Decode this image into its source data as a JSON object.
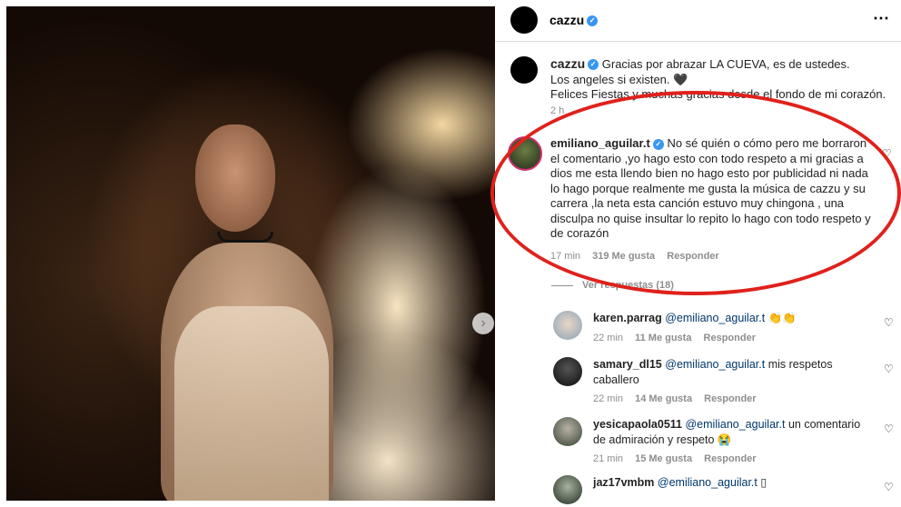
{
  "post": {
    "author": "cazzu",
    "caption_lines": [
      "Gracias por abrazar LA CUEVA, es de ustedes.",
      "Los angeles si existen. 🖤",
      "Felices Fiestas y muchas gracias desde el fondo de mi corazón."
    ],
    "caption_time": "2 h",
    "more_icon": "⋯",
    "next_icon": "›"
  },
  "main_comment": {
    "username": "emiliano_aguilar.t",
    "text": "No sé quién o cómo pero me borraron el comentario ,yo hago esto con todo respeto a mi gracias a dios me esta llendo bien no hago esto por publicidad ni nada lo hago porque realmente me gusta la música de cazzu y su carrera ,la neta esta canción estuvo muy chingona , una disculpa no quise insultar lo repito lo hago con todo respeto y de corazón",
    "time": "17 min",
    "likes": "319 Me gusta",
    "reply_label": "Responder"
  },
  "view_replies": "Ver respuestas (18)",
  "replies": [
    {
      "username": "karen.parrag",
      "mention": "@emiliano_aguilar.t",
      "text": "👏👏",
      "time": "22 min",
      "likes": "11 Me gusta",
      "reply_label": "Responder"
    },
    {
      "username": "samary_dl15",
      "mention": "@emiliano_aguilar.t",
      "text": "mis respetos caballero",
      "time": "22 min",
      "likes": "14 Me gusta",
      "reply_label": "Responder"
    },
    {
      "username": "yesicapaola0511",
      "mention": "@emiliano_aguilar.t",
      "text": "un comentario de admiración y respeto 😭",
      "time": "21 min",
      "likes": "15 Me gusta",
      "reply_label": "Responder"
    },
    {
      "username": "jaz17vmbm",
      "mention": "@emiliano_aguilar.t",
      "text": "▯",
      "time": "",
      "likes": "",
      "reply_label": ""
    }
  ],
  "icons": {
    "heart": "♡",
    "verified": "✓"
  },
  "colors": {
    "annotation": "#e0211c",
    "verified": "#3897f0",
    "mention": "#00376b",
    "muted": "#8e8e8e"
  }
}
